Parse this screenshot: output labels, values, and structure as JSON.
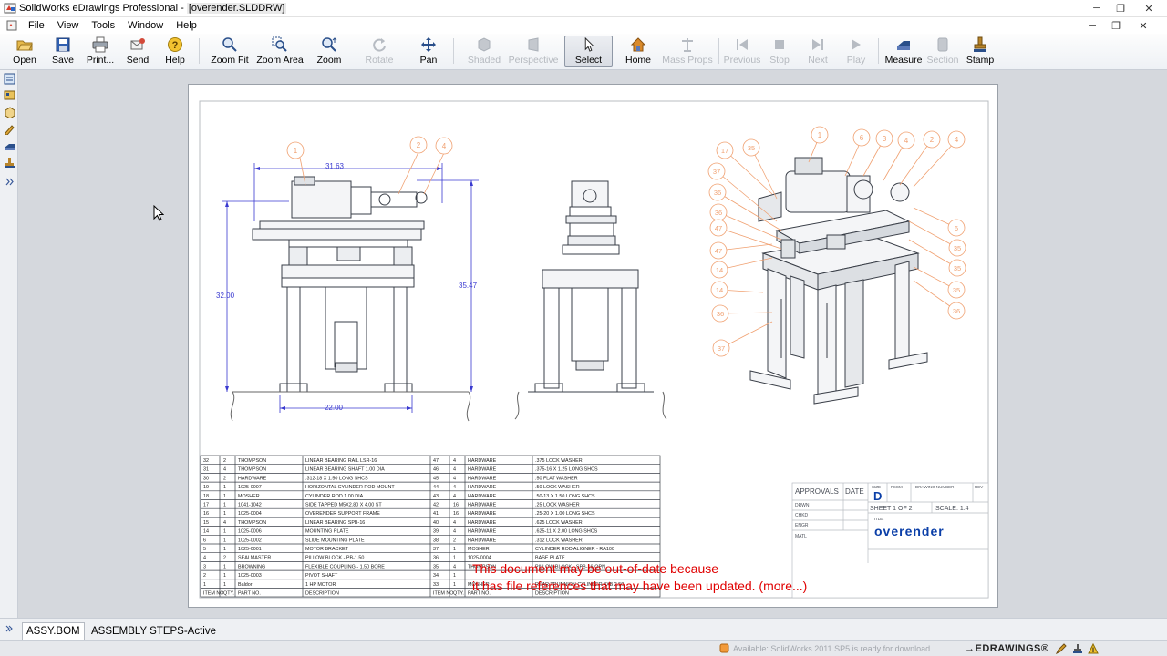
{
  "window": {
    "title_prefix": "SolidWorks eDrawings Professional - ",
    "document": "[overender.SLDDRW]",
    "minimize": "─",
    "restore": "❐",
    "close": "✕"
  },
  "menu": {
    "items": [
      "File",
      "View",
      "Tools",
      "Window",
      "Help"
    ],
    "doc_minimize": "─",
    "doc_restore": "❐",
    "doc_close": "✕"
  },
  "toolbar": {
    "buttons": [
      {
        "label": "Open",
        "icon": "folder-open-icon",
        "enabled": true
      },
      {
        "label": "Save",
        "icon": "floppy-disk-icon",
        "enabled": true
      },
      {
        "label": "Print...",
        "icon": "printer-icon",
        "enabled": true
      },
      {
        "label": "Send",
        "icon": "send-mail-icon",
        "enabled": true
      },
      {
        "label": "Help",
        "icon": "help-icon",
        "enabled": true
      },
      {
        "label": "Zoom Fit",
        "icon": "zoom-fit-icon",
        "enabled": true
      },
      {
        "label": "Zoom Area",
        "icon": "zoom-area-icon",
        "enabled": true
      },
      {
        "label": "Zoom",
        "icon": "zoom-icon",
        "enabled": true
      },
      {
        "label": "Rotate",
        "icon": "rotate-icon",
        "enabled": false
      },
      {
        "label": "Pan",
        "icon": "pan-icon",
        "enabled": true
      },
      {
        "label": "Shaded",
        "icon": "shaded-icon",
        "enabled": false
      },
      {
        "label": "Perspective",
        "icon": "perspective-icon",
        "enabled": false
      },
      {
        "label": "Select",
        "icon": "select-arrow-icon",
        "enabled": true,
        "active": true
      },
      {
        "label": "Home",
        "icon": "home-icon",
        "enabled": true
      },
      {
        "label": "Mass Props",
        "icon": "mass-props-icon",
        "enabled": false
      },
      {
        "label": "Previous",
        "icon": "previous-icon",
        "enabled": false
      },
      {
        "label": "Stop",
        "icon": "stop-icon",
        "enabled": false
      },
      {
        "label": "Next",
        "icon": "next-icon",
        "enabled": false
      },
      {
        "label": "Play",
        "icon": "play-icon",
        "enabled": false
      },
      {
        "label": "Measure",
        "icon": "measure-icon",
        "enabled": true
      },
      {
        "label": "Section",
        "icon": "section-icon",
        "enabled": false
      },
      {
        "label": "Stamp",
        "icon": "stamp-icon",
        "enabled": true
      }
    ]
  },
  "drawing": {
    "dimensions": {
      "top_width": "31.63",
      "left_height": "32.00",
      "right_height": "35.47",
      "bottom_width": "22.00"
    },
    "balloons_front": [
      "1",
      "2",
      "4"
    ],
    "balloons_iso_top": [
      "1",
      "6",
      "3",
      "4",
      "2",
      "4"
    ],
    "balloons_iso_left": [
      "17",
      "35",
      "37",
      "36",
      "36",
      "47",
      "47",
      "14",
      "14",
      "36",
      "37"
    ],
    "balloons_iso_right": [
      "6",
      "35",
      "35",
      "35",
      "36"
    ],
    "bom": {
      "footer_left": [
        "ITEM NO.",
        "QTY.",
        "PART NO.",
        "DESCRIPTION"
      ],
      "footer_right": [
        "ITEM NO.",
        "QTY.",
        "PART NO.",
        "DESCRIPTION"
      ],
      "rows_left": [
        [
          "32",
          "2",
          "THOMPSON",
          "LINEAR BEARING RAIL LSR-16"
        ],
        [
          "31",
          "4",
          "THOMPSON",
          "LINEAR BEARING SHAFT 1.00 DIA"
        ],
        [
          "30",
          "2",
          "HARDWARE",
          ".312-18 X 1.50 LONG SHCS"
        ],
        [
          "19",
          "1",
          "1025-0007",
          "HORIZONTAL CYLINDER ROD MOUNT"
        ],
        [
          "18",
          "1",
          "MOSHER",
          "CYLINDER ROD 1.00 DIA."
        ],
        [
          "17",
          "1",
          "1041-1042",
          "SIDE TAPPED M5X2.80 X 4.00 ST"
        ],
        [
          "16",
          "1",
          "1025-0004",
          "OVERENDER SUPPORT FRAME"
        ],
        [
          "15",
          "4",
          "THOMPSON",
          "LINEAR BEARING SPB-16"
        ],
        [
          "14",
          "1",
          "1025-0006",
          "MOUNTING PLATE"
        ],
        [
          "6",
          "1",
          "1025-0002",
          "SLIDE MOUNTING PLATE"
        ],
        [
          "5",
          "1",
          "1025-0001",
          "MOTOR BRACKET"
        ],
        [
          "4",
          "2",
          "SEALMASTER",
          "PILLOW BLOCK - PB-1.50"
        ],
        [
          "3",
          "1",
          "BROWNING",
          "FLEXIBLE COUPLING - 1.50 BORE"
        ],
        [
          "2",
          "1",
          "1025-0003",
          "PIVOT SHAFT"
        ],
        [
          "1",
          "1",
          "Baldor",
          "1 HP MOTOR"
        ]
      ],
      "rows_right": [
        [
          "47",
          "4",
          "HARDWARE",
          ".375 LOCK WASHER"
        ],
        [
          "46",
          "4",
          "HARDWARE",
          ".375-16 X 1.25 LONG SHCS"
        ],
        [
          "45",
          "4",
          "HARDWARE",
          ".50 FLAT WASHER"
        ],
        [
          "44",
          "4",
          "HARDWARE",
          ".50 LOCK WASHER"
        ],
        [
          "43",
          "4",
          "HARDWARE",
          ".50-13 X 1.50 LONG SHCS"
        ],
        [
          "42",
          "16",
          "HARDWARE",
          ".25 LOCK WASHER"
        ],
        [
          "41",
          "16",
          "HARDWARE",
          ".25-20 X 1.00 LONG SHCS"
        ],
        [
          "40",
          "4",
          "HARDWARE",
          ".625 LOCK WASHER"
        ],
        [
          "39",
          "4",
          "HARDWARE",
          ".625-11 X 2.00 LONG SHCS"
        ],
        [
          "38",
          "2",
          "HARDWARE",
          ".312 LOCK WASHER"
        ],
        [
          "37",
          "1",
          "MOSHER",
          "CYLINDER ROD ALIGNER - RA100"
        ],
        [
          "36",
          "1",
          "1025-0004",
          "BASE PLATE"
        ],
        [
          "35",
          "4",
          "THOMPSON",
          "PILLOW BLOCK - SPB-16-OPN"
        ],
        [
          "34",
          "1",
          "",
          ""
        ],
        [
          "33",
          "1",
          "MOSHER",
          "REAR TRUNNION CYLINDER  4XB 2.50"
        ]
      ]
    },
    "title_block": {
      "approvals": "APPROVALS",
      "date": "DATE",
      "drawn": "DRWN",
      "checked": "CHKD",
      "engineer": "ENGR",
      "material": "MATL",
      "size_label": "SIZE",
      "size": "D",
      "fscm": "FSCM",
      "drawing_number": "DRAWING NUMBER",
      "rev": "REV",
      "sheet": "SHEET  1  OF 2",
      "scale": "SCALE:  1:4",
      "title_label": "TITLE:",
      "title": "overender"
    },
    "warning_line1": "This document may be out-of-date because",
    "warning_line2": "it has file references that may have been updated. (more...)"
  },
  "tabs": {
    "items": [
      "ASSY.BOM",
      "ASSEMBLY STEPS-Active"
    ]
  },
  "status": {
    "update_text": "Available: SolidWorks 2011 SP5 is ready for download",
    "brand": "DRAWINGS®"
  },
  "colors": {
    "accent": "#0b3fa8",
    "balloon": "#f0a070",
    "dimension": "#3a3ad0",
    "warning": "#e00000"
  }
}
